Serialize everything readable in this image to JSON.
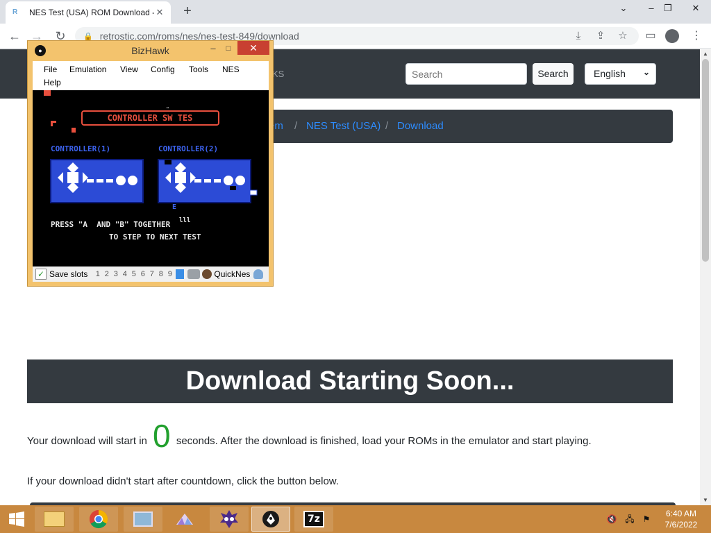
{
  "browser": {
    "tab_title": "NES Test (USA) ROM Download -",
    "favicon_text": "R",
    "tab_close": "✕",
    "new_tab": "+",
    "url": "retrostic.com/roms/nes/nes-test-849/download",
    "window_controls": {
      "dropdown": "⌄",
      "minimize": "–",
      "restore": "❐",
      "close": "✕"
    },
    "nav": {
      "back": "←",
      "forward": "→",
      "reload": "↻"
    },
    "omnibox_icons": {
      "lock": "🔒",
      "download": "⤓",
      "share": "⇪",
      "star": "☆"
    },
    "toolbar_icons": {
      "sidebar": "▭",
      "menu": "⋮"
    }
  },
  "site": {
    "header_fragment": "KS",
    "search_placeholder": "Search",
    "search_button": "Search",
    "language": "English",
    "language_chevron": "⌄",
    "breadcrumb": {
      "fragment": "em",
      "separator": "/",
      "game": "NES Test (USA)",
      "current": "Download"
    },
    "banner_title": "Download Starting Soon...",
    "countdown_prefix": "Your download will start in",
    "countdown_value": "0",
    "countdown_suffix": "seconds. After the download is finished, load your ROMs in the emulator and start playing.",
    "fallback_text": "If your download didn't start after countdown, click the button below."
  },
  "bizhawk": {
    "title": "BizHawk",
    "min": "–",
    "max": "□",
    "close": "✕",
    "menu": [
      "File",
      "Emulation",
      "View",
      "Config",
      "Tools",
      "NES",
      "Help"
    ],
    "screen": {
      "title": "CONTROLLER SW TES",
      "title_mark": "\"",
      "controller_1": "CONTROLLER(1)",
      "controller_2": "CONTROLLER(2)",
      "marker_e": "E",
      "marker_iii": "lll",
      "line_1": "PRESS \"A  AND \"B\" TOGETHER",
      "line_2": "TO STEP TO NEXT TEST"
    },
    "status": {
      "check": "✓",
      "save_slots_label": "Save slots",
      "slots": [
        "1",
        "2",
        "3",
        "4",
        "5",
        "6",
        "7",
        "8",
        "9"
      ],
      "core": "QuickNes"
    },
    "colors": {
      "frame": "#f3c36d",
      "nes_red": "#e84f3d",
      "nes_blue": "#2c4bd6",
      "nes_text": "#e8e8e8"
    }
  },
  "taskbar": {
    "time": "6:40 AM",
    "date": "7/6/2022",
    "apps": [
      "windows-start",
      "file-explorer",
      "chrome",
      "control-panel",
      "app-triangle",
      "app-mascot",
      "bizhawk",
      "7zip"
    ],
    "sevenzip_label": "7z"
  }
}
